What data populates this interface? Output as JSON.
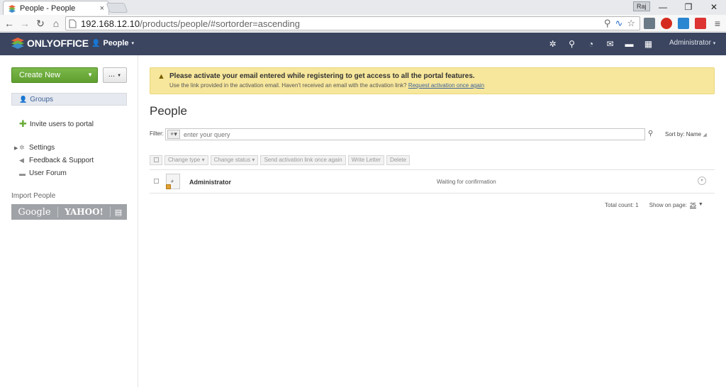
{
  "browser": {
    "tab_title": "People - People",
    "tab_close": "×",
    "profile": "Raj",
    "url_host": "192.168.12.10",
    "url_path": "/products/people/#sortorder=ascending",
    "win_min": "—",
    "win_restore": "❐",
    "win_close": "✕"
  },
  "appbar": {
    "logo": "ONLYOFFICE",
    "module": "People",
    "user": "Administrator"
  },
  "sidebar": {
    "create_new": "Create New",
    "more": "...",
    "groups": "Groups",
    "invite": "Invite users to portal",
    "settings": "Settings",
    "feedback": "Feedback & Support",
    "forum": "User Forum",
    "import_label": "Import People",
    "import_google": "Google",
    "import_yahoo": "YAHOO!"
  },
  "notice": {
    "headline": "Please activate your email entered while registering to get access to all the portal features.",
    "body": "Use the link provided in the activation email. Haven't received an email with the activation link?",
    "link": "Request activation once again"
  },
  "main": {
    "title": "People",
    "filter_label": "Filter:",
    "filter_placeholder": "enter your query",
    "sort_by": "Sort by: Name",
    "actions": {
      "change_type": "Change type ▾",
      "change_status": "Change status ▾",
      "send_activation": "Send activation link once again",
      "write_letter": "Write Letter",
      "delete": "Delete"
    },
    "rows": [
      {
        "name": "Administrator",
        "status": "Waiting for confirmation"
      }
    ],
    "total_count_label": "Total count:",
    "total_count": "1",
    "show_on_page_label": "Show on page:",
    "show_on_page": "25"
  }
}
